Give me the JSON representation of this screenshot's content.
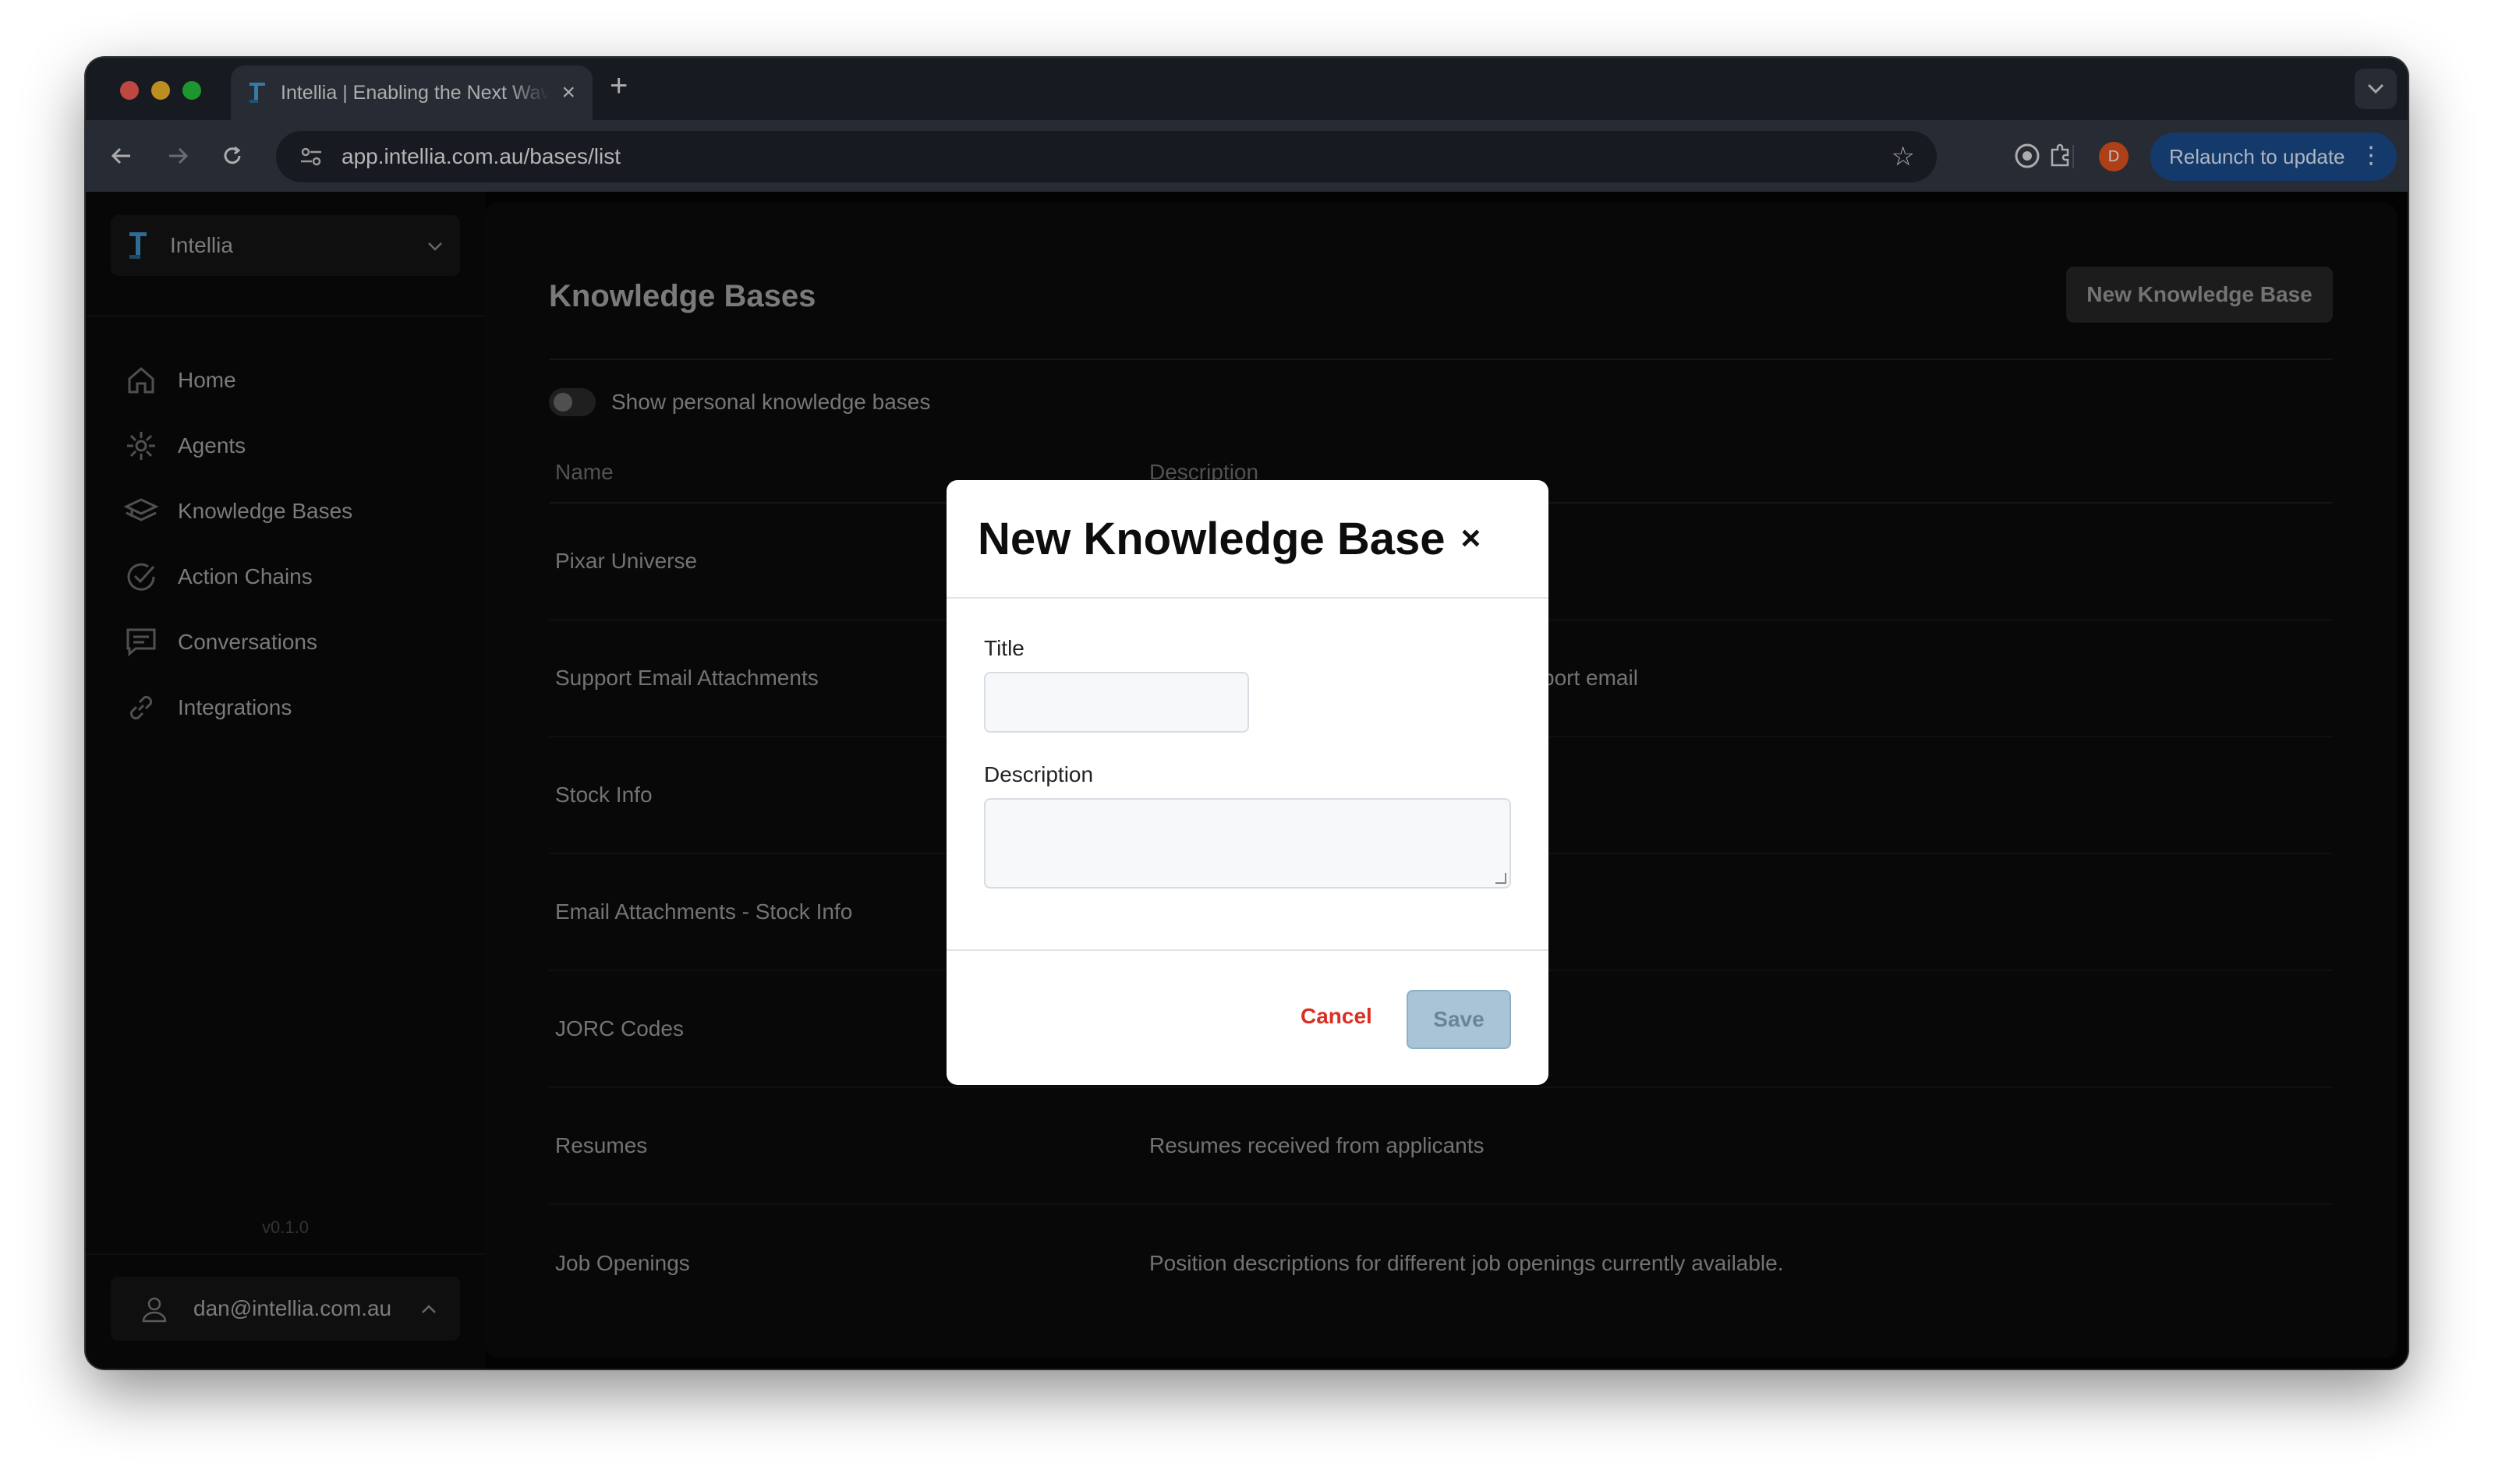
{
  "browser": {
    "tab_title": "Intellia | Enabling the Next Wave",
    "url": "app.intellia.com.au/bases/list",
    "profile_initial": "D",
    "relaunch_label": "Relaunch to update"
  },
  "sidebar": {
    "workspace_name": "Intellia",
    "items": [
      {
        "label": "Home",
        "icon": "home-icon"
      },
      {
        "label": "Agents",
        "icon": "agents-icon"
      },
      {
        "label": "Knowledge Bases",
        "icon": "knowledge-bases-icon"
      },
      {
        "label": "Action Chains",
        "icon": "check-circle-icon"
      },
      {
        "label": "Conversations",
        "icon": "chat-icon"
      },
      {
        "label": "Integrations",
        "icon": "link-icon"
      }
    ],
    "version": "v0.1.0",
    "user_email": "dan@intellia.com.au"
  },
  "main": {
    "title": "Knowledge Bases",
    "new_button_label": "New Knowledge Base",
    "toggle_label": "Show personal knowledge bases",
    "columns": {
      "name": "Name",
      "description": "Description"
    },
    "rows": [
      {
        "name": "Pixar Universe",
        "description": ""
      },
      {
        "name": "Support Email Attachments",
        "description": "port email"
      },
      {
        "name": "Stock Info",
        "description": ""
      },
      {
        "name": "Email Attachments - Stock Info",
        "description": ""
      },
      {
        "name": "JORC Codes",
        "description": ""
      },
      {
        "name": "Resumes",
        "description": "Resumes received from applicants"
      },
      {
        "name": "Job Openings",
        "description": "Position descriptions for different job openings currently available."
      }
    ]
  },
  "modal": {
    "title": "New Knowledge Base",
    "title_field_label": "Title",
    "title_value": "",
    "description_field_label": "Description",
    "description_value": "",
    "cancel_label": "Cancel",
    "save_label": "Save"
  },
  "colors": {
    "accent_blue": "#1a4e8f",
    "cancel_red": "#d93025",
    "save_disabled": "#a9c4d6"
  }
}
